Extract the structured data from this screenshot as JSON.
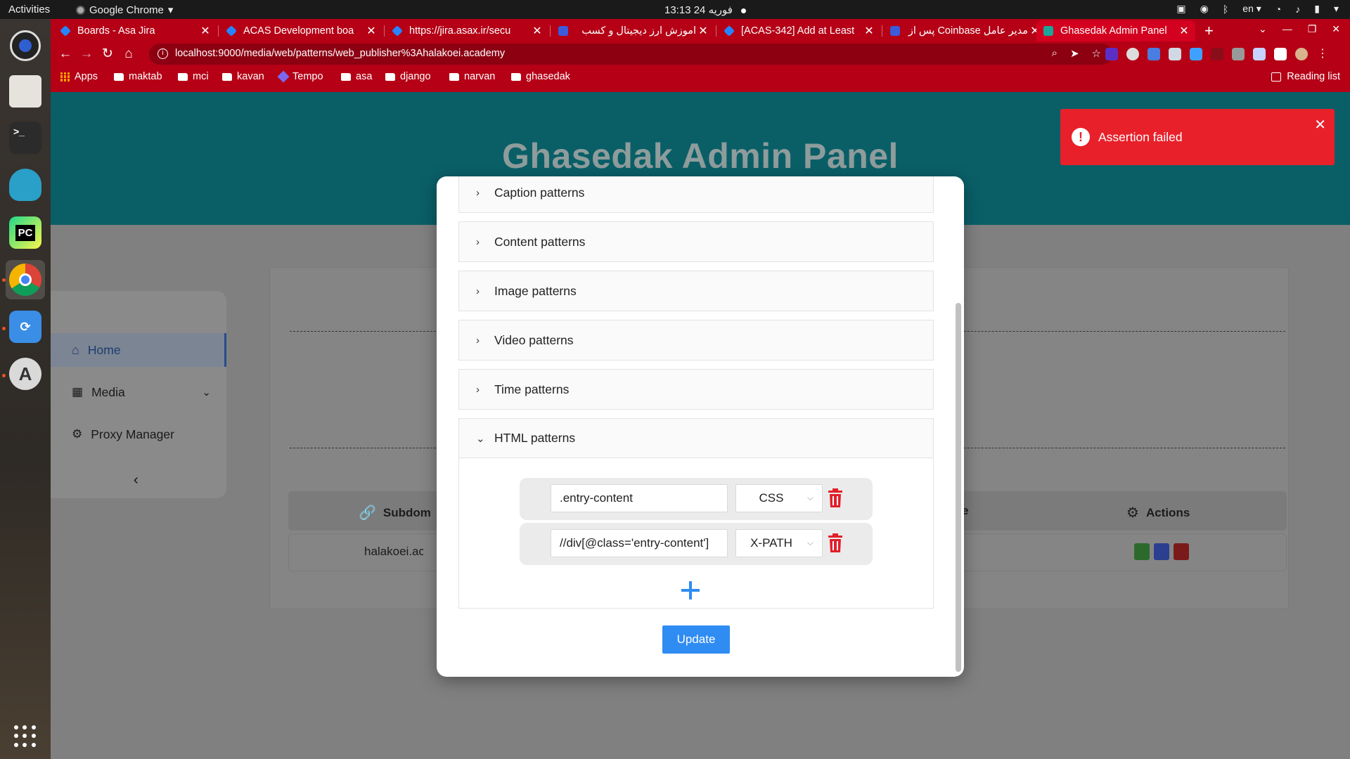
{
  "os": {
    "activities": "Activities",
    "app_name": "Google Chrome",
    "clock": "13:13  24 فوریه",
    "lang": "en"
  },
  "browser": {
    "tabs": [
      {
        "label": "Boards - Asa Jira",
        "icon": "jira-icon"
      },
      {
        "label": "ACAS Development boa",
        "icon": "jira-icon"
      },
      {
        "label": "https://jira.asax.ir/secu",
        "icon": "jira-icon"
      },
      {
        "label": "آموزش ارز دیجیتال و کسب",
        "icon": "site-icon"
      },
      {
        "label": "[ACAS-342] Add at Least",
        "icon": "jira-icon"
      },
      {
        "label": "مدیر عامل Coinbase پس از",
        "icon": "site-icon"
      },
      {
        "label": "Ghasedak Admin Panel",
        "icon": "ghasedak-icon"
      }
    ],
    "url": "localhost:9000/media/web/patterns/web_publisher%3Ahalakoei.academy",
    "bookmarks": [
      "Apps",
      "maktab",
      "mci",
      "kavan",
      "Tempo",
      "asa",
      "django",
      "narvan",
      "ghasedak"
    ],
    "reading_list": "Reading list"
  },
  "page": {
    "title": "Ghasedak Admin Panel",
    "sidebar": {
      "items": [
        {
          "label": "Home"
        },
        {
          "label": "Media"
        },
        {
          "label": "Proxy Manager"
        }
      ]
    },
    "table": {
      "headers": [
        "Subdomain",
        "Actions"
      ],
      "header_suffix": "e",
      "rows": [
        {
          "subdomain": "halakoei.aca"
        }
      ]
    }
  },
  "modal": {
    "panels": [
      {
        "label": "Caption patterns",
        "open": false
      },
      {
        "label": "Content patterns",
        "open": false
      },
      {
        "label": "Image patterns",
        "open": false
      },
      {
        "label": "Video patterns",
        "open": false
      },
      {
        "label": "Time patterns",
        "open": false
      },
      {
        "label": "HTML patterns",
        "open": true
      }
    ],
    "html_patterns": [
      {
        "value": ".entry-content",
        "type": "CSS"
      },
      {
        "value": "//div[@class='entry-content']",
        "type": "X-PATH"
      }
    ],
    "update_label": "Update"
  },
  "toast": {
    "message": "Assertion failed",
    "color": "#e8202a"
  },
  "colors": {
    "chrome_accent": "#b50016",
    "hero": "#0a5f67",
    "primary_button": "#2f8cf2",
    "danger": "#e0202a"
  }
}
